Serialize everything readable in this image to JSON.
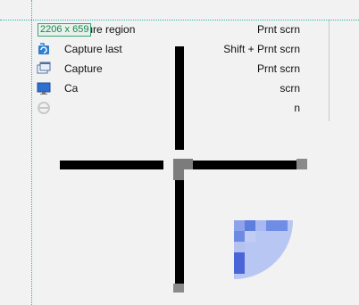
{
  "capture_menu": {
    "items": [
      {
        "label": "Capture region",
        "shortcut": "Prnt scrn",
        "icon": "region-icon"
      },
      {
        "label": "Capture last",
        "shortcut": "Shift + Prnt scrn",
        "icon": "capture-last-icon"
      },
      {
        "label": "Capture",
        "shortcut": "Prnt scrn",
        "icon": "window-icon"
      },
      {
        "label": "Ca",
        "shortcut": "scrn",
        "icon": "fullscreen-icon"
      },
      {
        "label": "",
        "shortcut": "n",
        "icon": "web-icon"
      }
    ]
  },
  "selection": {
    "size_readout": "2206 x 659"
  },
  "colors": {
    "guide": "#33b3a8",
    "badge_border": "#38a374",
    "magnifier": "#5d7ddf"
  }
}
